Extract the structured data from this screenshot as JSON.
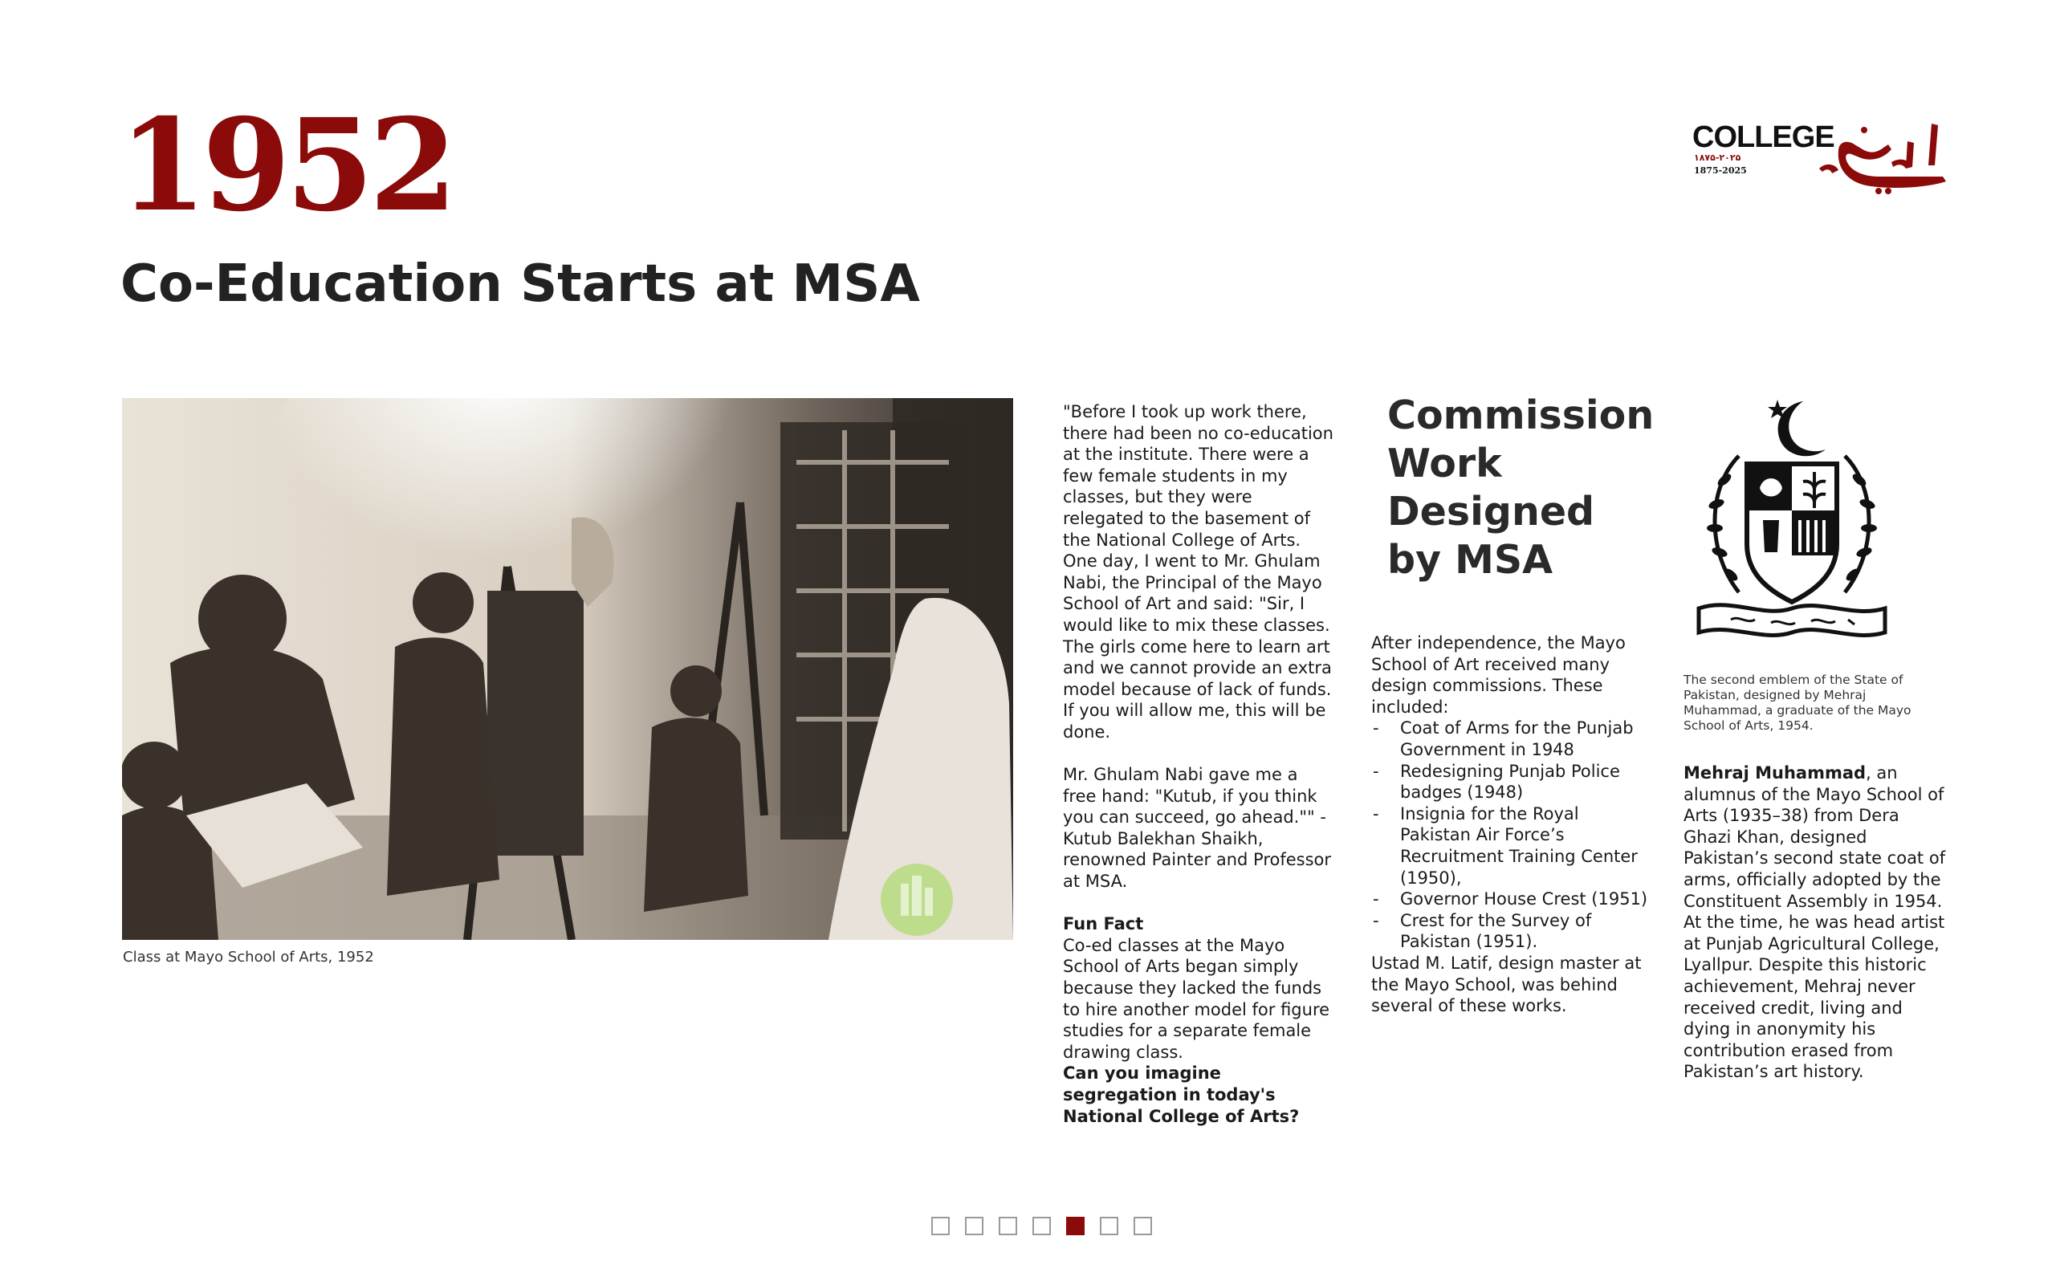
{
  "header": {
    "year": "1952",
    "title": "Co-Education Starts at MSA"
  },
  "logo": {
    "word": "COLLEGE",
    "dates_urdu": "۱۸۷۵-۲۰۲۵",
    "dates": "1875-2025",
    "urdu_word": "کہانی"
  },
  "photo": {
    "icon": "building-watermark-icon",
    "caption": "Class at Mayo School of Arts, 1952"
  },
  "quote": {
    "text": "\"Before I took up work there, there had been no co-education at the institute. There were a few female students in my classes, but they were relegated to the basement of the National College of Arts. One day, I went to Mr. Ghulam Nabi, the Principal of the Mayo School of Art and said: \"Sir, I would like to mix these classes. The girls come here to learn art and we cannot provide an extra model because of lack of funds. If you will allow me, this will be done.",
    "text2": "Mr. Ghulam Nabi gave me a free hand: \"Kutub, if you think you can succeed, go ahead.\"\" - Kutub Balekhan Shaikh, renowned Painter and Professor at MSA.",
    "fun_fact_heading": "Fun Fact",
    "fun_fact_text": "Co-ed classes at the Mayo School of Arts began simply because they lacked the funds to hire another model for figure studies for a separate female drawing class.",
    "fun_fact_question": "Can you imagine segregation in today's National College of Arts?"
  },
  "commission": {
    "title": "Commission Work Designed by MSA",
    "intro": "After independence, the Mayo School of Art received many design commissions. These included:",
    "items": [
      "Coat of Arms for the Punjab Government in 1948",
      "Redesigning Punjab Police badges (1948)",
      "Insignia for the Royal Pakistan Air Force’s Recruitment Training Center (1950),",
      "Governor House Crest (1951)",
      "Crest for the Survey of Pakistan (1951)."
    ],
    "outro": "Ustad M. Latif, design master at the Mayo School, was behind several of these works."
  },
  "emblem": {
    "icon": "state-emblem-icon",
    "caption": "The second emblem of the State of Pakistan, designed by Mehraj Muhammad, a graduate of the Mayo School of Arts, 1954."
  },
  "mehraj": {
    "name": "Mehraj Muhammad",
    "text": ", an alumnus of the Mayo School of Arts (1935–38) from Dera Ghazi Khan, designed Pakistan’s second state coat of arms, officially adopted by the Constituent Assembly in 1954. At the time, he was head artist at Punjab Agricultural College, Lyallpur. Despite this historic achievement, Mehraj never received credit, living and dying in anonymity his contribution erased from Pakistan’s art history."
  },
  "pager": {
    "count": 7,
    "active_index": 4
  },
  "colors": {
    "accent": "#8b0a0a",
    "text": "#1a1a1a"
  }
}
